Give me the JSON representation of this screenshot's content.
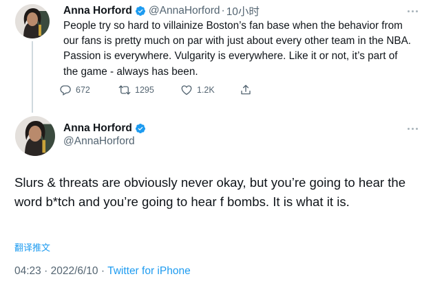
{
  "accent_color": "#1d9bf0",
  "secondary_text_color": "#536471",
  "tweets": [
    {
      "author_name": "Anna Horford",
      "handle": "@AnnaHorford",
      "separator": "·",
      "time_ago": "10小时",
      "text": "People try so hard to villainize Boston’s fan base when the behavior from our fans is pretty much on par with just about every other team in the NBA. Passion is everywhere. Vulgarity is everywhere. Like it or not, it’s part of the game - always has been.",
      "replies": "672",
      "retweets": "1295",
      "likes": "1.2K",
      "icons": [
        "verified-badge-icon",
        "more-icon",
        "reply-icon",
        "retweet-icon",
        "like-icon",
        "share-icon"
      ]
    },
    {
      "author_name": "Anna Horford",
      "handle": "@AnnaHorford",
      "text": "Slurs & threats are obviously never okay, but you’re going to hear the word b*tch and you’re going to hear f bombs. It is what it is.",
      "translate_label": "翻译推文",
      "time": "04:23",
      "separator": "·",
      "date": "2022/6/10",
      "source": "Twitter for iPhone"
    }
  ]
}
